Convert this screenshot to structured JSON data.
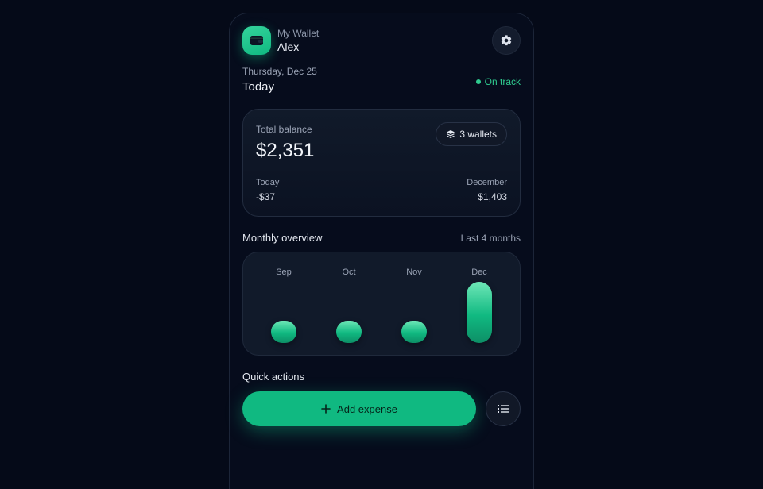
{
  "header": {
    "label": "My Wallet",
    "name": "Alex"
  },
  "day": {
    "date": "Thursday, Dec 25",
    "title": "Today",
    "status": "On track"
  },
  "balance": {
    "label": "Total balance",
    "value": "$2,351",
    "wallets": "3 wallets",
    "today_label": "Today",
    "today_value": "-$37",
    "month_label": "December",
    "month_value": "$1,403"
  },
  "overview": {
    "title": "Monthly overview",
    "range": "Last 4 months"
  },
  "chart_data": {
    "type": "bar",
    "categories": [
      "Sep",
      "Oct",
      "Nov",
      "Dec"
    ],
    "values": [
      16,
      16,
      16,
      100
    ],
    "ylim": [
      0,
      100
    ],
    "title": "",
    "xlabel": "",
    "ylabel": "",
    "grid": false
  },
  "quick_actions": {
    "title": "Quick actions",
    "add_label": "Add expense"
  },
  "icons": {
    "wallet": "wallet-icon",
    "settings": "gear-icon",
    "wallets": "layers-icon",
    "add": "plus-icon",
    "list": "list-icon"
  },
  "colors": {
    "accent": "#10b981",
    "status": "#2fcb8f",
    "background": "#050a18"
  }
}
